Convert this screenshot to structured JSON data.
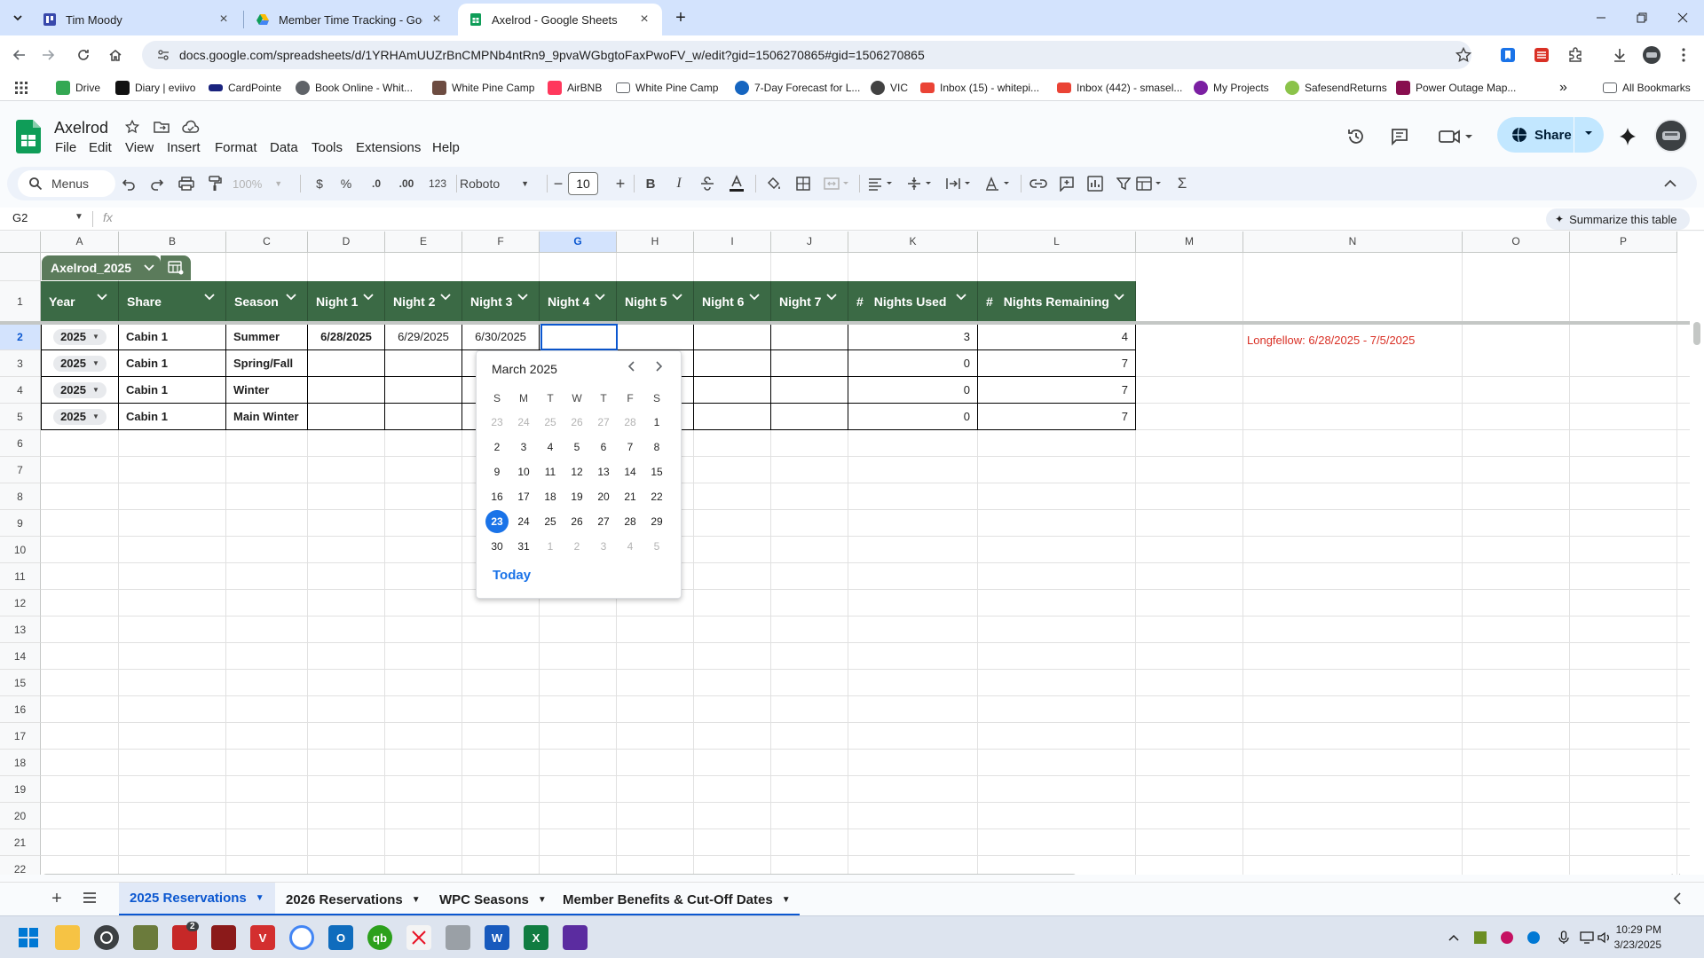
{
  "browser": {
    "tabs": [
      {
        "title": "Tim Moody",
        "favicon": "planner-icon",
        "active": false
      },
      {
        "title": "Member Time Tracking - Googl",
        "favicon": "drive-icon",
        "active": false
      },
      {
        "title": "Axelrod - Google Sheets",
        "favicon": "sheets-icon",
        "active": true
      }
    ],
    "url": "docs.google.com/spreadsheets/d/1YRHAmUUZrBnCMPNb4ntRn9_9pvaWGbgtoFaxPwoFV_w/edit?gid=1506270865#gid=1506270865",
    "bookmarks": [
      {
        "label": "Drive",
        "color": "#34a853"
      },
      {
        "label": "Diary | eviivo",
        "color": "#111111"
      },
      {
        "label": "CardPointe",
        "color": "#1a237e"
      },
      {
        "label": "Book Online - Whit...",
        "color": "#5f6368"
      },
      {
        "label": "White Pine Camp",
        "color": "#6d4c41"
      },
      {
        "label": "AirBNB",
        "color": "#ff385c"
      },
      {
        "label": "White Pine Camp",
        "color": "#5f6368"
      },
      {
        "label": "7-Day Forecast for L...",
        "color": "#1565c0"
      },
      {
        "label": "VIC",
        "color": "#424242"
      },
      {
        "label": "Inbox (15) - whitepi...",
        "color": "#ea4335"
      },
      {
        "label": "Inbox (442) - smasel...",
        "color": "#ea4335"
      },
      {
        "label": "My Projects",
        "color": "#7b1fa2"
      },
      {
        "label": "SafesendReturns",
        "color": "#8bc34a"
      },
      {
        "label": "Power Outage Map...",
        "color": "#880e4f"
      }
    ],
    "all_bookmarks_label": "All Bookmarks"
  },
  "app": {
    "doc_title": "Axelrod",
    "menus": [
      "File",
      "Edit",
      "View",
      "Insert",
      "Format",
      "Data",
      "Tools",
      "Extensions",
      "Help"
    ],
    "share_label": "Share",
    "toolbar": {
      "menus_search": "Menus",
      "zoom": "100%",
      "currency": "$",
      "percent": "%",
      "dec_decrease": ".0",
      "dec_increase": ".00",
      "number_format": "123",
      "font": "Roboto",
      "font_size": "10",
      "bold": "B",
      "italic": "I"
    },
    "name_box": "G2",
    "fx_label": "fx",
    "summarize_label": "Summarize this table",
    "accent_color": "#0b57d0",
    "table_header_color": "#3b6a45"
  },
  "grid": {
    "columns": [
      "A",
      "B",
      "C",
      "D",
      "E",
      "F",
      "G",
      "H",
      "I",
      "J",
      "K",
      "L",
      "M",
      "N",
      "O",
      "P"
    ],
    "selected_column": "G",
    "selected_row": "2",
    "rows": [
      "1",
      "2",
      "3",
      "4",
      "5",
      "6",
      "7",
      "8",
      "9",
      "10",
      "11",
      "12",
      "13",
      "14",
      "15",
      "16",
      "17",
      "18",
      "19",
      "20",
      "21",
      "22"
    ],
    "table_name": "Axelrod_2025",
    "table_headers": [
      "Year",
      "Share",
      "Season",
      "Night 1",
      "Night 2",
      "Night 3",
      "Night 4",
      "Night 5",
      "Night 6",
      "Night 7",
      "Nights Used",
      "Nights Remaining"
    ],
    "number_header_prefix": "#",
    "table_rows": [
      [
        "2025",
        "Cabin 1",
        "Summer",
        "6/28/2025",
        "6/29/2025",
        "6/30/2025",
        "",
        "",
        "",
        "",
        "3",
        "4"
      ],
      [
        "2025",
        "Cabin 1",
        "Spring/Fall",
        "",
        "",
        "",
        "",
        "",
        "",
        "",
        "0",
        "7"
      ],
      [
        "2025",
        "Cabin 1",
        "Winter",
        "",
        "",
        "",
        "",
        "",
        "",
        "",
        "0",
        "7"
      ],
      [
        "2025",
        "Cabin 1",
        "Main Winter",
        "",
        "",
        "",
        "",
        "",
        "",
        "",
        "0",
        "7"
      ]
    ],
    "note": "Longfellow: 6/28/2025 - 7/5/2025",
    "note_color": "#d93025"
  },
  "datepicker": {
    "month_label": "March 2025",
    "weekdays": [
      "S",
      "M",
      "T",
      "W",
      "T",
      "F",
      "S"
    ],
    "weeks": [
      [
        "23",
        "24",
        "25",
        "26",
        "27",
        "28",
        "1"
      ],
      [
        "2",
        "3",
        "4",
        "5",
        "6",
        "7",
        "8"
      ],
      [
        "9",
        "10",
        "11",
        "12",
        "13",
        "14",
        "15"
      ],
      [
        "16",
        "17",
        "18",
        "19",
        "20",
        "21",
        "22"
      ],
      [
        "23",
        "24",
        "25",
        "26",
        "27",
        "28",
        "29"
      ],
      [
        "30",
        "31",
        "1",
        "2",
        "3",
        "4",
        "5"
      ]
    ],
    "selected_day": "23",
    "today_label": "Today"
  },
  "sheet_tabs": [
    {
      "label": "2025 Reservations",
      "active": true
    },
    {
      "label": "2026 Reservations",
      "active": false
    },
    {
      "label": "WPC Seasons",
      "active": false
    },
    {
      "label": "Member Benefits & Cut-Off Dates",
      "active": false
    }
  ],
  "taskbar": {
    "badge_count": "2",
    "time": "10:29 PM",
    "date": "3/23/2025"
  }
}
